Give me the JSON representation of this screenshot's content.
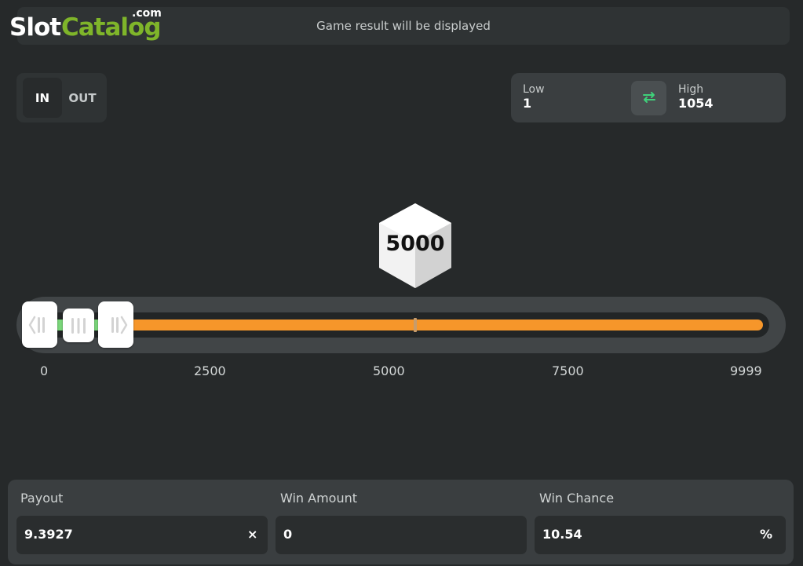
{
  "logo": {
    "slot": "Slot",
    "catalog": "Catalog",
    "com": ".com"
  },
  "result_message": "Game result will be displayed",
  "mode": {
    "in_label": "IN",
    "out_label": "OUT",
    "selected": "IN"
  },
  "range": {
    "low_label": "Low",
    "low_value": "1",
    "high_label": "High",
    "high_value": "1054",
    "swap_icon": "swap-arrows-icon"
  },
  "dice": {
    "value": "5000"
  },
  "slider": {
    "ticks": [
      "0",
      "2500",
      "5000",
      "7500",
      "9999"
    ],
    "colors": {
      "in_range": "#7ad77a",
      "out_range": "#f6962a"
    }
  },
  "stats": {
    "payout": {
      "label": "Payout",
      "value": "9.3927",
      "suffix": "×"
    },
    "win_amount": {
      "label": "Win Amount",
      "value": "0"
    },
    "win_chance": {
      "label": "Win Chance",
      "value": "10.54",
      "suffix": "%"
    }
  }
}
